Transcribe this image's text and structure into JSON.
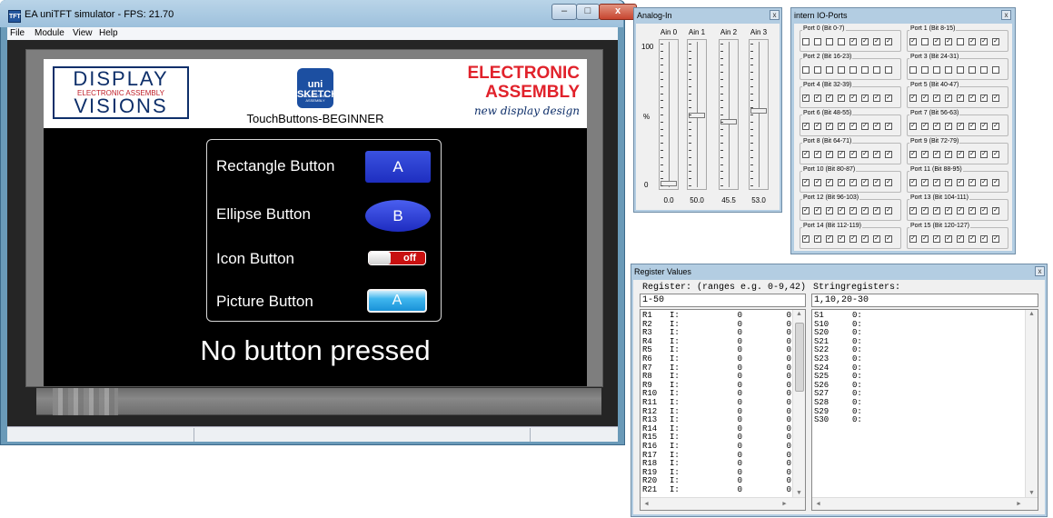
{
  "main_window": {
    "title": "EA uniTFT simulator - FPS:  21.70",
    "icon_text": "TFT",
    "controls": {
      "minimize": "–",
      "maximize": "□",
      "close": "x"
    },
    "menu": [
      "File",
      "Module",
      "View",
      "Help"
    ]
  },
  "display": {
    "dv_logo": {
      "top": "DISPLAY",
      "middle": "ELECTRONIC ASSEMBLY",
      "bottom": "VISIONS"
    },
    "uni_logo": {
      "main": "uni SKETCH",
      "sub": "ELECTRONIC ASSEMBLY"
    },
    "banner_title": "TouchButtons-BEGINNER",
    "ea_logo": {
      "line1": "ELECTRONIC",
      "line2": "ASSEMBLY",
      "tagline": "new display design"
    },
    "buttons": [
      {
        "label": "Rectangle Button",
        "text": "A"
      },
      {
        "label": "Ellipse Button",
        "text": "B"
      },
      {
        "label": "Icon Button",
        "text": "off"
      },
      {
        "label": "Picture Button",
        "text": "A"
      }
    ],
    "status": "No button pressed"
  },
  "analog": {
    "title": "Analog-In",
    "close": "x",
    "scale": {
      "top": "100",
      "mid": "%",
      "bottom": "0"
    },
    "channels": [
      {
        "name": "Ain 0",
        "value": "0.0",
        "level": 0.0
      },
      {
        "name": "Ain 1",
        "value": "50.0",
        "level": 0.5
      },
      {
        "name": "Ain 2",
        "value": "45.5",
        "level": 0.455
      },
      {
        "name": "Ain 3",
        "value": "53.0",
        "level": 0.53
      }
    ]
  },
  "io": {
    "title": "intern IO-Ports",
    "close": "x",
    "ports": [
      {
        "label": "Port 0 (Bit 0-7)",
        "bits": [
          0,
          0,
          0,
          0,
          1,
          1,
          1,
          1
        ]
      },
      {
        "label": "Port 1 (Bit 8-15)",
        "bits": [
          1,
          0,
          1,
          1,
          0,
          1,
          1,
          1
        ]
      },
      {
        "label": "Port 2 (Bit 16-23)",
        "bits": [
          0,
          0,
          0,
          0,
          0,
          0,
          0,
          0
        ]
      },
      {
        "label": "Port 3 (Bit 24-31)",
        "bits": [
          0,
          0,
          0,
          0,
          0,
          0,
          0,
          0
        ]
      },
      {
        "label": "Port 4 (Bit 32-39)",
        "bits": [
          1,
          1,
          1,
          1,
          1,
          1,
          1,
          1
        ]
      },
      {
        "label": "Port 5 (Bit 40-47)",
        "bits": [
          1,
          1,
          1,
          1,
          1,
          1,
          1,
          1
        ]
      },
      {
        "label": "Port 6 (Bit 48-55)",
        "bits": [
          1,
          1,
          1,
          1,
          1,
          1,
          1,
          1
        ]
      },
      {
        "label": "Port 7 (Bit 56-63)",
        "bits": [
          1,
          1,
          1,
          1,
          1,
          1,
          1,
          1
        ]
      },
      {
        "label": "Port 8 (Bit 64-71)",
        "bits": [
          1,
          1,
          1,
          1,
          1,
          1,
          1,
          1
        ]
      },
      {
        "label": "Port 9 (Bit 72-79)",
        "bits": [
          1,
          1,
          1,
          1,
          1,
          1,
          1,
          1
        ]
      },
      {
        "label": "Port 10 (Bit 80-87)",
        "bits": [
          1,
          1,
          1,
          1,
          1,
          1,
          1,
          1
        ]
      },
      {
        "label": "Port 11 (Bit 88-95)",
        "bits": [
          1,
          1,
          1,
          1,
          1,
          1,
          1,
          1
        ]
      },
      {
        "label": "Port 12 (Bit 96-103)",
        "bits": [
          1,
          1,
          1,
          1,
          1,
          1,
          1,
          1
        ]
      },
      {
        "label": "Port 13 (Bit 104-111)",
        "bits": [
          1,
          1,
          1,
          1,
          1,
          1,
          1,
          1
        ]
      },
      {
        "label": "Port 14 (Bit 112-119)",
        "bits": [
          1,
          1,
          1,
          1,
          1,
          1,
          1,
          1
        ]
      },
      {
        "label": "Port 15 (Bit 120-127)",
        "bits": [
          1,
          1,
          1,
          1,
          1,
          1,
          1,
          1
        ]
      }
    ]
  },
  "registers": {
    "title": "Register Values",
    "close": "x",
    "reg_label": "Register: (ranges e.g. 0-9,42)",
    "str_label": "Stringregisters:",
    "reg_input": "1-50",
    "str_input": "1,10,20-30",
    "rows": [
      {
        "name": "R1",
        "type": "I:",
        "a": "0",
        "b": "0"
      },
      {
        "name": "R2",
        "type": "I:",
        "a": "0",
        "b": "0"
      },
      {
        "name": "R3",
        "type": "I:",
        "a": "0",
        "b": "0"
      },
      {
        "name": "R4",
        "type": "I:",
        "a": "0",
        "b": "0"
      },
      {
        "name": "R5",
        "type": "I:",
        "a": "0",
        "b": "0"
      },
      {
        "name": "R6",
        "type": "I:",
        "a": "0",
        "b": "0"
      },
      {
        "name": "R7",
        "type": "I:",
        "a": "0",
        "b": "0"
      },
      {
        "name": "R8",
        "type": "I:",
        "a": "0",
        "b": "0"
      },
      {
        "name": "R9",
        "type": "I:",
        "a": "0",
        "b": "0"
      },
      {
        "name": "R10",
        "type": "I:",
        "a": "0",
        "b": "0"
      },
      {
        "name": "R11",
        "type": "I:",
        "a": "0",
        "b": "0"
      },
      {
        "name": "R12",
        "type": "I:",
        "a": "0",
        "b": "0"
      },
      {
        "name": "R13",
        "type": "I:",
        "a": "0",
        "b": "0"
      },
      {
        "name": "R14",
        "type": "I:",
        "a": "0",
        "b": "0"
      },
      {
        "name": "R15",
        "type": "I:",
        "a": "0",
        "b": "0"
      },
      {
        "name": "R16",
        "type": "I:",
        "a": "0",
        "b": "0"
      },
      {
        "name": "R17",
        "type": "I:",
        "a": "0",
        "b": "0"
      },
      {
        "name": "R18",
        "type": "I:",
        "a": "0",
        "b": "0"
      },
      {
        "name": "R19",
        "type": "I:",
        "a": "0",
        "b": "0"
      },
      {
        "name": "R20",
        "type": "I:",
        "a": "0",
        "b": "0"
      },
      {
        "name": "R21",
        "type": "I:",
        "a": "0",
        "b": "0"
      }
    ],
    "strings": [
      {
        "name": "S1",
        "value": "0:"
      },
      {
        "name": "S10",
        "value": "0:"
      },
      {
        "name": "S20",
        "value": "0:"
      },
      {
        "name": "S21",
        "value": "0:"
      },
      {
        "name": "S22",
        "value": "0:"
      },
      {
        "name": "S23",
        "value": "0:"
      },
      {
        "name": "S24",
        "value": "0:"
      },
      {
        "name": "S25",
        "value": "0:"
      },
      {
        "name": "S26",
        "value": "0:"
      },
      {
        "name": "S27",
        "value": "0:"
      },
      {
        "name": "S28",
        "value": "0:"
      },
      {
        "name": "S29",
        "value": "0:"
      },
      {
        "name": "S30",
        "value": "0:"
      }
    ]
  }
}
